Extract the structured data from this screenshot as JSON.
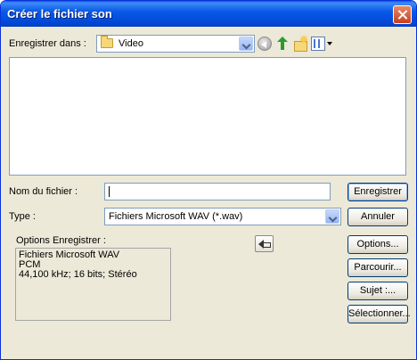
{
  "dialog": {
    "title": "Créer le fichier son"
  },
  "location": {
    "label": "Enregistrer dans :",
    "selected": "Video",
    "toolbar_icons": [
      "back-icon",
      "up-folder-icon",
      "new-folder-icon",
      "views-menu-icon"
    ]
  },
  "filename": {
    "label": "Nom du fichier :",
    "value": ""
  },
  "type": {
    "label": "Type :",
    "selected": "Fichiers Microsoft WAV (*.wav)"
  },
  "options": {
    "label": "Options Enregistrer :",
    "lines": [
      "Fichiers Microsoft WAV",
      "PCM",
      "44,100 kHz; 16 bits; Stéréo"
    ]
  },
  "buttons": {
    "save": "Enregistrer",
    "cancel": "Annuler",
    "options": "Options...",
    "browse": "Parcourir...",
    "subject": "Sujet :...",
    "select": "Sélectionner..."
  },
  "colors": {
    "titlebar": "#0a5ae8",
    "dialog_bg": "#ece9d8",
    "button_border": "#003c74"
  }
}
